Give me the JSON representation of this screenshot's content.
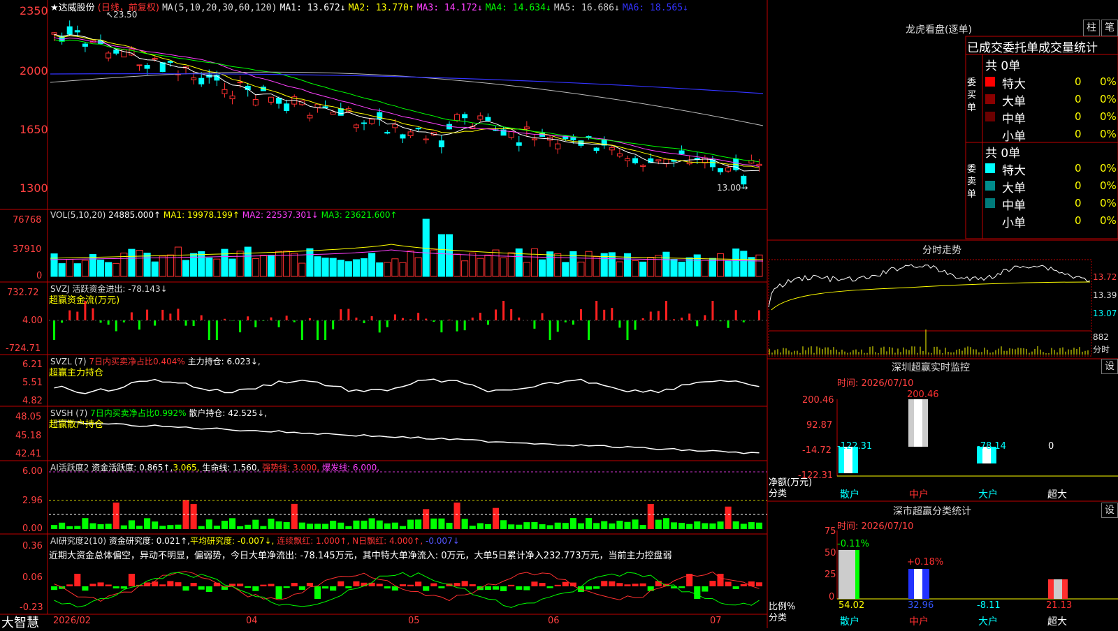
{
  "stock": {
    "name": "★达威股份",
    "mode": "(日线，前复权)",
    "ma_params": "MA(5,10,20,30,60,120)",
    "ma_values": [
      "MA1: 13.672↓",
      "MA2: 13.770↑",
      "MA3: 14.172↓",
      "MA4: 14.634↓",
      "MA5: 16.686↓",
      "MA6: 18.565↓"
    ],
    "high_mark": "23.50",
    "low_mark": "13.00"
  },
  "price_axis": [
    "2350",
    "2000",
    "1650",
    "1300"
  ],
  "vol": {
    "params": "VOL(5,10,20)",
    "value": "24885.000↑",
    "ma1": "MA1: 19978.199↑",
    "ma2": "MA2: 22537.301↓",
    "ma3": "MA3: 23621.600↑",
    "axis": [
      "76768",
      "37910",
      "0"
    ]
  },
  "svzj": {
    "label": "SVZJ",
    "desc": "活跃资金进出: -78.143↓",
    "desc2": "超赢资金流(万元)",
    "axis": [
      "732.72",
      "4.00",
      "-724.71"
    ]
  },
  "svzl": {
    "label": "SVZL (7)",
    "ratio": "7日内买卖净占比0.404%",
    "hold": "主力持仓: 6.023↓,",
    "desc2": "超赢主力持仓",
    "axis": [
      "6.21",
      "5.51",
      "4.82"
    ]
  },
  "svsh": {
    "label": "SVSH (7)",
    "ratio": "7日内买卖净占比0.992%",
    "hold": "散户持仓: 42.525↓,",
    "desc2": "超赢散户持仓",
    "axis": [
      "48.05",
      "45.18",
      "42.41"
    ]
  },
  "ai1": {
    "label": "AI活跃度2",
    "a": "资金活跃度: 0.865↑,",
    "b": "3.065,",
    "c": "生命线: 1.560,",
    "d": "强势线: 3.000,",
    "e": "爆发线: 6.000,",
    "axis": [
      "6.00",
      "2.96",
      "0.00"
    ]
  },
  "ai2": {
    "label": "AI研究度2(10)",
    "a": "资金研究度: 0.021↑,",
    "b": "平均研究度: -0.007↓,",
    "c": "连续飘红: 1.000↑,",
    "d": "N日飘红: 4.000↑,",
    "e": "-0.007↓",
    "axis": [
      "0.36",
      "0.06",
      "-0.23"
    ],
    "summary": "近期大资金总体偏空，异动不明显，偏弱势，今日大单净流出: -78.145万元，其中特大单净流入: 0万元，大单5日累计净入232.773万元，当前主力控盘弱"
  },
  "date_axis": [
    "2026/02",
    "04",
    "05",
    "06",
    "07"
  ],
  "logo": "大智慧",
  "right": {
    "title": "龙虎看盘(逐单)",
    "btn1": "柱",
    "btn2": "笔",
    "table_header": "已成交委托单成交量统计",
    "buy_label": "委买单",
    "sell_label": "委卖单",
    "buy_total": "共 0单",
    "sell_total": "共 0单",
    "buy_rows": [
      {
        "name": "特大",
        "count": "0",
        "pct": "0%",
        "color": "#ff0000"
      },
      {
        "name": "大单",
        "count": "0",
        "pct": "0%",
        "color": "#8b0000"
      },
      {
        "name": "中单",
        "count": "0",
        "pct": "0%",
        "color": "#6b0000"
      },
      {
        "name": "小单",
        "count": "0",
        "pct": "0%",
        "color": ""
      }
    ],
    "sell_rows": [
      {
        "name": "特大",
        "count": "0",
        "pct": "0%",
        "color": "#00ffff"
      },
      {
        "name": "大单",
        "count": "0",
        "pct": "0%",
        "color": "#008b8b"
      },
      {
        "name": "中单",
        "count": "0",
        "pct": "0%",
        "color": "#007a7a"
      },
      {
        "name": "小单",
        "count": "0",
        "pct": "0%",
        "color": ""
      }
    ],
    "trend_title": "分时走势",
    "trend_axis": [
      "13.72",
      "13.39",
      "13.07"
    ],
    "trend_vol": [
      "882",
      "分时"
    ],
    "sz_title": "深圳超赢实时监控",
    "sz_btn": "设",
    "sz_time": "时间: 2026/07/10",
    "sz_axis": [
      "200.46",
      "92.87",
      "-14.72",
      "-122.31"
    ],
    "sz_unit": "净额(万元)",
    "sz_cat": "分类",
    "sz_values": [
      "-122.31",
      "200.46",
      "-78.14",
      "0"
    ],
    "sz_cats": [
      "散户",
      "中户",
      "大户",
      "超大"
    ],
    "cls_title": "深市超赢分类统计",
    "cls_btn": "设",
    "cls_time": "时间: 2026/07/10",
    "cls_axis": [
      "75",
      "50",
      "25",
      "0"
    ],
    "cls_unit": "比例%",
    "cls_cat": "分类",
    "cls_top": [
      "-0.11%",
      "+0.18%"
    ],
    "cls_values": [
      "54.02",
      "32.96",
      "-8.11",
      "21.13"
    ],
    "cls_cats": [
      "散户",
      "中户",
      "大户",
      "超大"
    ]
  }
}
